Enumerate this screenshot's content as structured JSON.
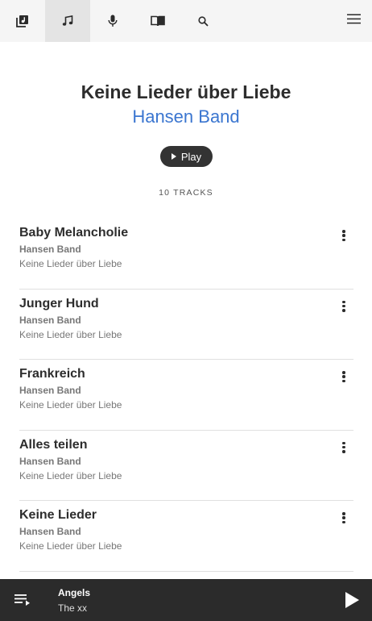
{
  "nav": {
    "tabs": [
      {
        "icon": "library-icon",
        "active": false
      },
      {
        "icon": "music-note-icon",
        "active": true
      },
      {
        "icon": "microphone-icon",
        "active": false
      },
      {
        "icon": "book-icon",
        "active": false
      },
      {
        "icon": "search-icon",
        "active": false
      }
    ],
    "menu_icon": "hamburger-menu-icon"
  },
  "album": {
    "title": "Keine Lieder über Liebe",
    "artist": "Hansen Band",
    "play_label": "Play",
    "track_count": "10 TRACKS"
  },
  "tracks": [
    {
      "title": "Baby Melancholie",
      "artist": "Hansen Band",
      "album": "Keine Lieder über Liebe"
    },
    {
      "title": "Junger Hund",
      "artist": "Hansen Band",
      "album": "Keine Lieder über Liebe"
    },
    {
      "title": "Frankreich",
      "artist": "Hansen Band",
      "album": "Keine Lieder über Liebe"
    },
    {
      "title": "Alles teilen",
      "artist": "Hansen Band",
      "album": "Keine Lieder über Liebe"
    },
    {
      "title": "Keine Lieder",
      "artist": "Hansen Band",
      "album": "Keine Lieder über Liebe"
    }
  ],
  "now_playing": {
    "title": "Angels",
    "artist": "The xx"
  },
  "colors": {
    "accent": "#3b76d0",
    "player_bg": "#2b2b2b",
    "nav_bg": "#f5f5f5"
  }
}
